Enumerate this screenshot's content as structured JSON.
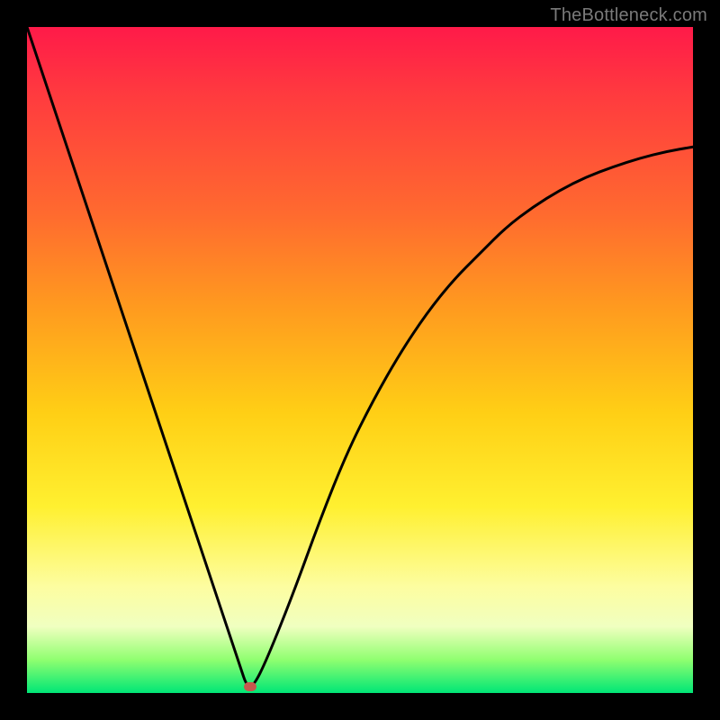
{
  "watermark": "TheBottleneck.com",
  "chart_data": {
    "type": "line",
    "title": "",
    "xlabel": "",
    "ylabel": "",
    "xlim": [
      0,
      100
    ],
    "ylim": [
      0,
      100
    ],
    "grid": false,
    "legend": false,
    "series": [
      {
        "name": "curve",
        "x": [
          0,
          4,
          8,
          12,
          16,
          20,
          24,
          28,
          30,
          32,
          33,
          34,
          36,
          40,
          44,
          48,
          52,
          56,
          60,
          64,
          68,
          72,
          76,
          80,
          84,
          88,
          92,
          96,
          100
        ],
        "y": [
          100,
          88,
          76,
          64,
          52,
          40,
          28,
          16,
          10,
          4,
          1,
          1,
          5,
          15,
          26,
          36,
          44,
          51,
          57,
          62,
          66,
          70,
          73,
          75.5,
          77.5,
          79,
          80.3,
          81.3,
          82
        ]
      }
    ],
    "marker": {
      "x": 33.5,
      "y": 1
    },
    "gradient_stops": [
      {
        "pos": 0,
        "color": "#ff1a49"
      },
      {
        "pos": 28,
        "color": "#ff6a2f"
      },
      {
        "pos": 58,
        "color": "#ffcf15"
      },
      {
        "pos": 84,
        "color": "#fdfda0"
      },
      {
        "pos": 100,
        "color": "#00e676"
      }
    ]
  }
}
